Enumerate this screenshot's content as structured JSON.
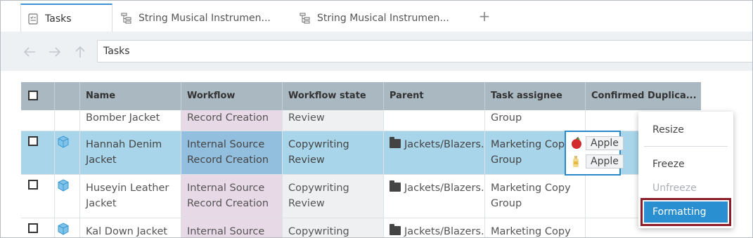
{
  "tabs": [
    {
      "label": "Tasks",
      "icon": "task-list-icon"
    },
    {
      "label": "String Musical Instrumen...",
      "icon": "hierarchy-icon"
    },
    {
      "label": "String Musical Instrumen...",
      "icon": "hierarchy-icon"
    }
  ],
  "address": "Tasks",
  "columns": [
    "Name",
    "Workflow",
    "Workflow state",
    "Parent",
    "Task assignee",
    "Confirmed Duplica..."
  ],
  "rows": [
    {
      "name": "Bomber Jacket",
      "workflow": "Record Creation",
      "state": "Review",
      "parent": "",
      "assignee": "Group"
    },
    {
      "name": "Hannah Denim Jacket",
      "workflow": "Internal Source Record Creation",
      "state": "Copywriting Review",
      "parent": "Jackets/Blazers...",
      "assignee": "Marketing Copy Group"
    },
    {
      "name": "Huseyin Leather Jacket",
      "workflow": "Internal Source Record Creation",
      "state": "Copywriting Review",
      "parent": "Jackets/Blazers...",
      "assignee": "Marketing Copy Group"
    },
    {
      "name": "Kal Down Jacket",
      "workflow": "Internal Source",
      "state": "Copywriting",
      "parent": "Jackets/Blazers...",
      "assignee": "Marketing Copy"
    }
  ],
  "duplicates": [
    "Apple",
    "Apple"
  ],
  "menu": {
    "resize": "Resize",
    "freeze": "Freeze",
    "unfreeze": "Unfreeze",
    "formatting": "Formatting"
  },
  "colors": {
    "accent": "#2a8fd0",
    "selected_row": "#a8d5ea",
    "header": "#aab8c2",
    "highlight_border": "#8b1c28"
  }
}
